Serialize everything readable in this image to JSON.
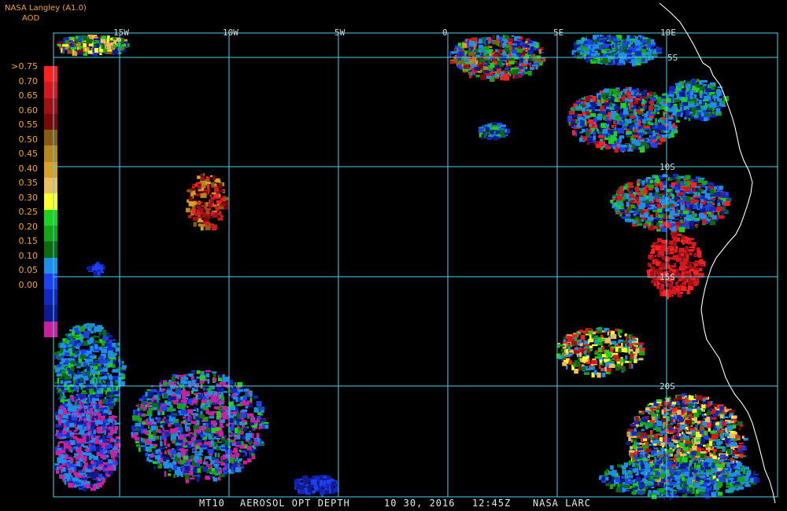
{
  "header": {
    "producer": "NASA Langley (A1.0)",
    "product": "AOD"
  },
  "legend": {
    "labels": [
      ">0.75",
      "0.70",
      "0.65",
      "0.60",
      "0.55",
      "0.50",
      "0.45",
      "0.40",
      "0.35",
      "0.30",
      "0.25",
      "0.20",
      "0.15",
      "0.10",
      "0.05",
      "0.00"
    ],
    "colors": [
      "#ff2020",
      "#d41820",
      "#a01016",
      "#7a0a0a",
      "#8a5a14",
      "#b8861e",
      "#d8a028",
      "#ecbf60",
      "#ffff30",
      "#20d020",
      "#14a414",
      "#0e6a0e",
      "#1e8ee8",
      "#1e40f0",
      "#1428c0",
      "#101a90",
      "#c8209e"
    ]
  },
  "map": {
    "longitude_labels": [
      "15W",
      "10W",
      "5W",
      "0",
      "5E",
      "10E"
    ],
    "latitude_labels": [
      "5S",
      "10S",
      "15S",
      "20S"
    ],
    "grid_color": "#4fd2e6",
    "coast_color": "#ffffff",
    "background": "#000000"
  },
  "footer": {
    "product_id": "MT10",
    "product_name": "AEROSOL OPT DEPTH",
    "date": "10 30, 2016",
    "time": "12:45Z",
    "source": "NASA LARC"
  }
}
